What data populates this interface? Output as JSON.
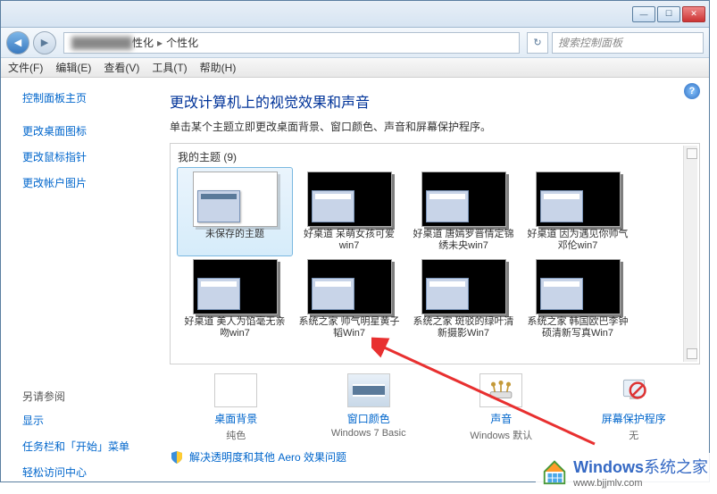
{
  "titlebar": {},
  "breadcrumb": {
    "part_hidden": "████████",
    "part1": "性化",
    "part2": "个性化"
  },
  "search": {
    "placeholder": "搜索控制面板"
  },
  "menu": {
    "file": "文件(F)",
    "edit": "编辑(E)",
    "view": "查看(V)",
    "tools": "工具(T)",
    "help": "帮助(H)"
  },
  "sidebar": {
    "home": "控制面板主页",
    "items": [
      "更改桌面图标",
      "更改鼠标指针",
      "更改帐户图片"
    ],
    "seealso_h": "另请参阅",
    "seealso": [
      "显示",
      "任务栏和「开始」菜单",
      "轻松访问中心"
    ]
  },
  "main": {
    "heading": "更改计算机上的视觉效果和声音",
    "subtitle": "单击某个主题立即更改桌面背景、窗口颜色、声音和屏幕保护程序。",
    "group_label": "我的主题 (9)",
    "themes": [
      {
        "name": "未保存的主题",
        "white": true,
        "selected": true
      },
      {
        "name": "好桌道 呆萌女孩可爱win7"
      },
      {
        "name": "好桌道 唐嫣罗晋情定锦绣未央win7"
      },
      {
        "name": "好桌道 因为遇见你帅气邓伦win7"
      },
      {
        "name": "好桌道 美人为馅毫无亲吻win7"
      },
      {
        "name": "系统之家 帅气明星黄子韬Win7"
      },
      {
        "name": "系统之家 斑驳的绿叶清新摄影Win7"
      },
      {
        "name": "系统之家 韩国欧巴李钟硕清新写真Win7"
      }
    ]
  },
  "controls": {
    "bg": {
      "label": "桌面背景",
      "sub": "纯色"
    },
    "color": {
      "label": "窗口颜色",
      "sub": "Windows 7 Basic"
    },
    "sound": {
      "label": "声音",
      "sub": "Windows 默认"
    },
    "saver": {
      "label": "屏幕保护程序",
      "sub": "无"
    }
  },
  "footer": {
    "link": "解决透明度和其他 Aero 效果问题"
  },
  "watermark": {
    "brand": "Windows",
    "sub": "系统之家",
    "url": "www.bjjmlv.com"
  }
}
